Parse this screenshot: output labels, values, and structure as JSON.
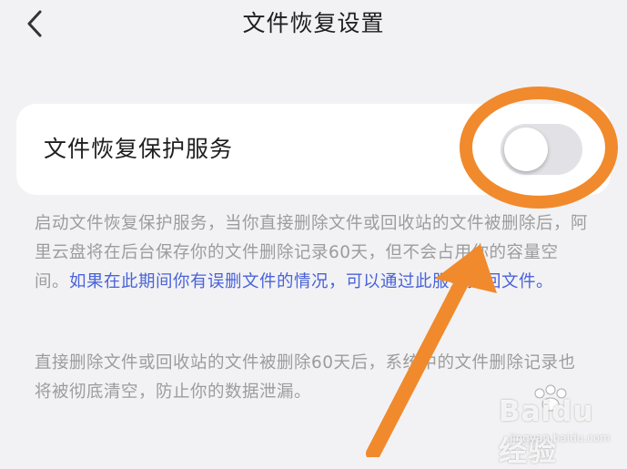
{
  "header": {
    "back_icon": "chevron-left-icon",
    "title": "文件恢复设置"
  },
  "setting": {
    "label": "文件恢复保护服务",
    "toggle_on": false
  },
  "description1": {
    "text": "启动文件恢复保护服务，当你直接删除文件或回收站的文件被删除后，阿里云盘将在后台保存你的文件删除记录60天，但不会占用你的容量空间。",
    "link": "如果在此期间你有误删文件的情况，可以通过此服务找回文件。"
  },
  "description2": {
    "text": "直接删除文件或回收站的文件被删除60天后，系统中的文件删除记录也将被彻底清空，防止你的数据泄漏。"
  },
  "watermark": {
    "text": "Baidu 经验",
    "sub": "jingyan.baidu.com"
  },
  "colors": {
    "background": "#f2f2f4",
    "link": "#4a63d8",
    "annotation": "#f08a2c"
  }
}
